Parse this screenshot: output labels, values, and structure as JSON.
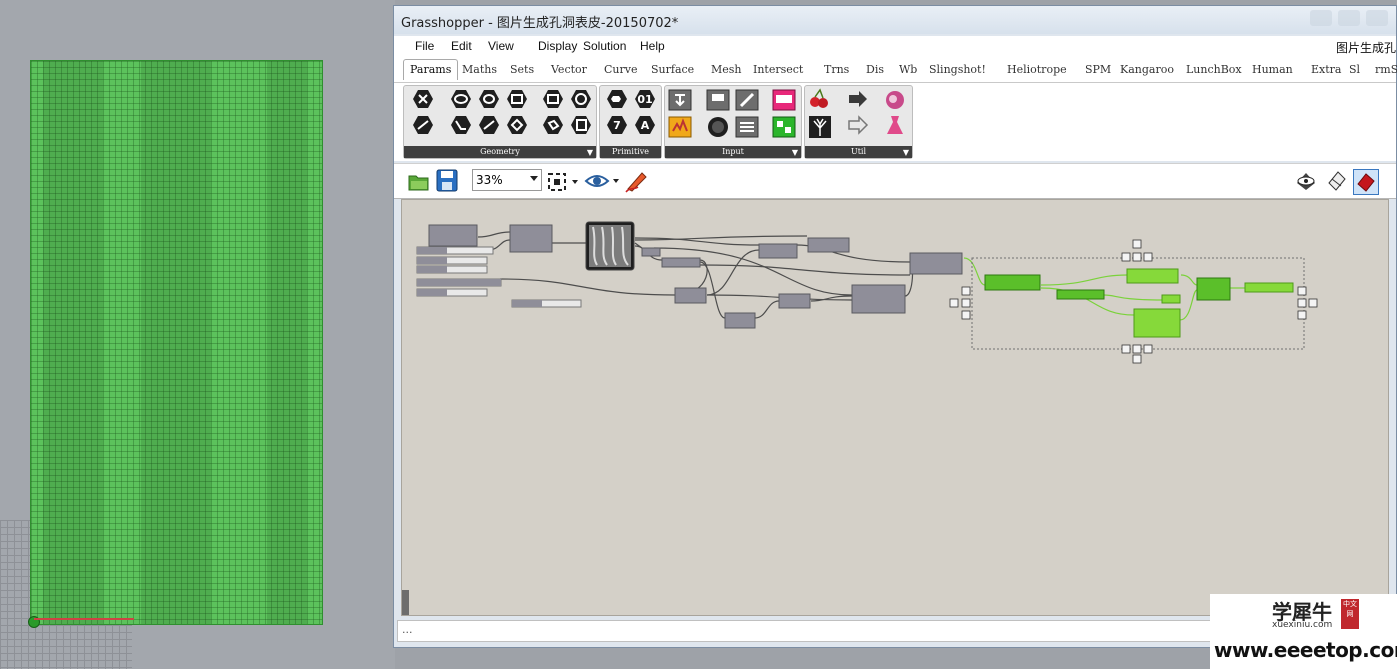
{
  "window": {
    "title": "Grasshopper - 图片生成孔洞表皮-20150702*",
    "right_label": "图片生成孔"
  },
  "menu": [
    "File",
    "Edit",
    "View",
    "Display",
    "Solution",
    "Help"
  ],
  "tabs": [
    "Params",
    "Maths",
    "Sets",
    "Vector",
    "Curve",
    "Surface",
    "Mesh",
    "Intersect",
    "Trns",
    "Dis",
    "Wb",
    "Slingshot!",
    "Heliotrope",
    "SPM",
    "Kangaroo",
    "LunchBox",
    "Human",
    "Extra",
    "Sl",
    "rmSc"
  ],
  "active_tab": "Params",
  "ribbon_groups": {
    "geometry": "Geometry",
    "primitive": "Primitive",
    "input": "Input",
    "util": "Util"
  },
  "toolbar": {
    "zoom": "33%"
  },
  "status": {
    "text": "..."
  },
  "watermark": {
    "site_cn": "学犀牛",
    "seal": "中文网",
    "site_en": "xuexiniu.com",
    "url": "www.eeeetop.com"
  },
  "colors": {
    "canvas": "#d4d0c8",
    "component": "#8f8e99",
    "selected": "#5bbf2a",
    "panel_green": "#5cc25c"
  },
  "icons": [
    "geometry-icons",
    "primitive-icons",
    "input-icons",
    "util-icons",
    "open-icon",
    "save-icon",
    "zoom-extents-icon",
    "preview-eye-icon",
    "sketch-icon",
    "preview-mode-icons"
  ]
}
